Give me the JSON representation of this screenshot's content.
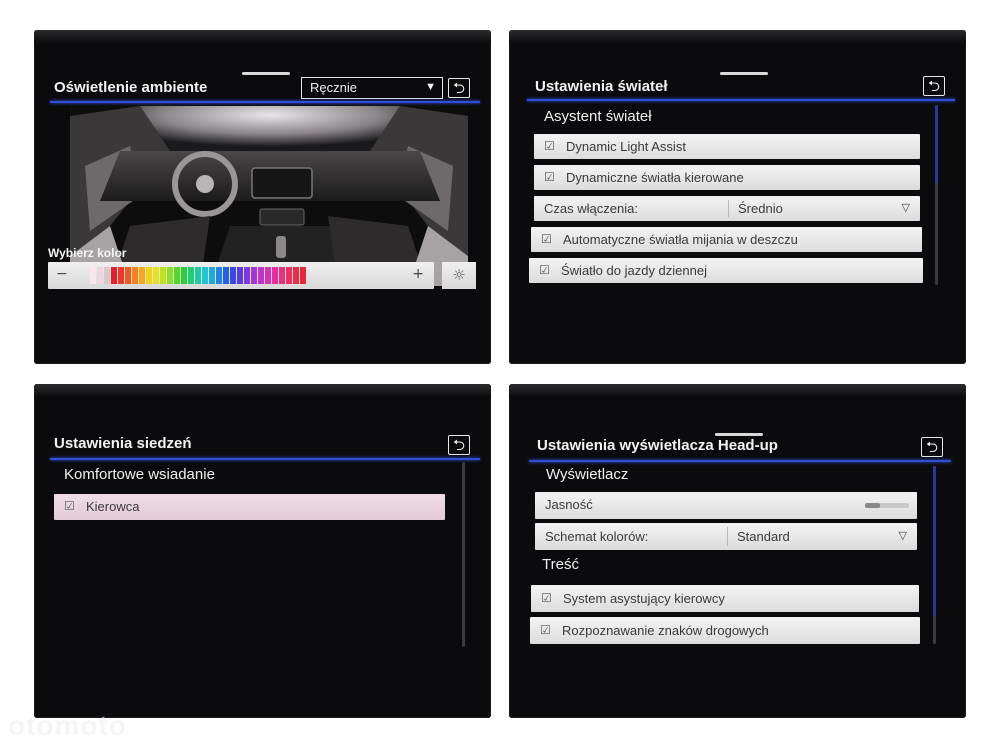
{
  "ambient": {
    "title": "Oświetlenie ambiente",
    "mode": "Ręcznie",
    "back_symbol": "⮌",
    "color_label": "Wybierz kolor",
    "minus": "−",
    "plus": "+",
    "sun_symbol": "☼",
    "swatch_colors": [
      "#f8e6ea",
      "#ead8dc",
      "#d8c8cc",
      "#e81d2a",
      "#f0362a",
      "#f25a1c",
      "#f6821a",
      "#f7a81a",
      "#f4cf1c",
      "#e3e41e",
      "#bde51f",
      "#8ede22",
      "#55d62a",
      "#2bcf3d",
      "#22cc72",
      "#20c9a6",
      "#1fc7d6",
      "#1fa9e3",
      "#2084e6",
      "#2260e6",
      "#3a48e3",
      "#5a3be0",
      "#8138dc",
      "#a334d6",
      "#c232cc",
      "#d930b8",
      "#e62f9c",
      "#ec2f7e",
      "#ee2f5f",
      "#ec2c45",
      "#e82838"
    ]
  },
  "lights": {
    "title": "Ustawienia świateł",
    "back_symbol": "⮌",
    "section": "Asystent świateł",
    "items": [
      {
        "check": "☑",
        "label": "Dynamic Light Assist"
      },
      {
        "check": "☑",
        "label": "Dynamiczne światła kierowane"
      }
    ],
    "select": {
      "label": "Czas włączenia:",
      "value": "Średnio",
      "caret": "▽"
    },
    "items2": [
      {
        "check": "☑",
        "label": "Automatyczne światła mijania w deszczu"
      },
      {
        "check": "☑",
        "label": "Światło do jazdy dziennej"
      }
    ]
  },
  "seats": {
    "title": "Ustawienia siedzeń",
    "back_symbol": "⮌",
    "section": "Komfortowe wsiadanie",
    "item": {
      "check": "☑",
      "label": "Kierowca"
    }
  },
  "hud": {
    "title": "Ustawienia wyświetlacza Head-up",
    "back_symbol": "⮌",
    "section1": "Wyświetlacz",
    "brightness": {
      "label": "Jasność",
      "level": 0.35
    },
    "scheme": {
      "label": "Schemat kolorów:",
      "value": "Standard",
      "caret": "▽"
    },
    "section2": "Treść",
    "items": [
      {
        "check": "☑",
        "label": "System asystujący kierowcy"
      },
      {
        "check": "☑",
        "label": "Rozpoznawanie znaków drogowych"
      }
    ]
  },
  "watermark": "otomoto"
}
